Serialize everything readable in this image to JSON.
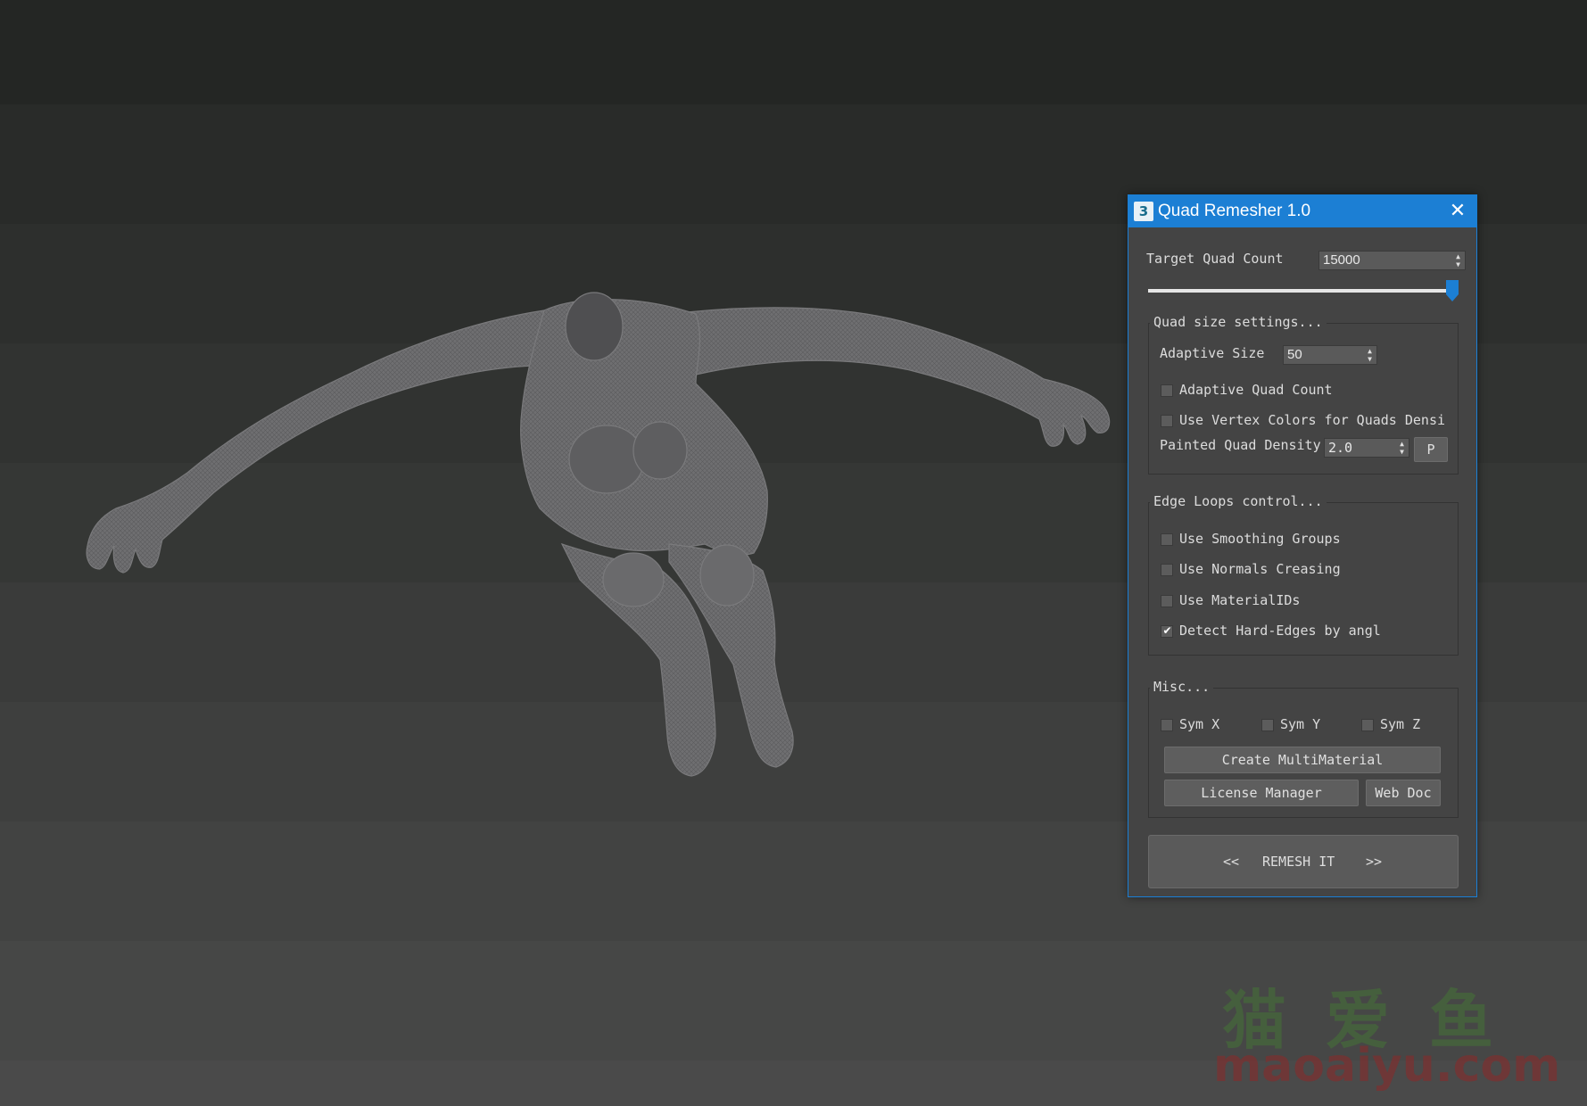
{
  "dialog": {
    "title": "Quad Remesher 1.0",
    "app_icon_glyph": "3",
    "close_glyph": "✕"
  },
  "target_quad_count": {
    "label": "Target Quad Count",
    "value": "15000",
    "slider_position": 0.98
  },
  "quad_size": {
    "title": "Quad size settings...",
    "adaptive_size_label": "Adaptive Size",
    "adaptive_size_value": "50",
    "adaptive_quad_count_label": "Adaptive Quad Count",
    "adaptive_quad_count_checked": false,
    "vertex_colors_label": "Use Vertex Colors for Quads Densi",
    "vertex_colors_checked": false,
    "painted_density_label": "Painted Quad Density",
    "painted_density_value": "2.0",
    "paint_button_label": "P"
  },
  "edge_loops": {
    "title": "Edge Loops control...",
    "items": [
      {
        "label": "Use Smoothing Groups",
        "checked": false
      },
      {
        "label": "Use Normals Creasing",
        "checked": false
      },
      {
        "label": "Use MaterialIDs",
        "checked": false
      },
      {
        "label": "Detect Hard-Edges by angl",
        "checked": true
      }
    ]
  },
  "misc": {
    "title": "Misc...",
    "sym": [
      {
        "label": "Sym X",
        "checked": false
      },
      {
        "label": "Sym Y",
        "checked": false
      },
      {
        "label": "Sym Z",
        "checked": false
      }
    ],
    "create_multimaterial_label": "Create MultiMaterial",
    "license_manager_label": "License Manager",
    "web_doc_label": "Web Doc"
  },
  "remesh": {
    "left_arrows": "<<",
    "label": "REMESH IT",
    "right_arrows": ">>"
  },
  "watermark": {
    "chinese": "猫爱鱼",
    "domain": "maoaiyu.com"
  },
  "colors": {
    "title_bar": "#1c7fd4",
    "dialog_bg": "#444444",
    "slider_thumb": "#1c7fd4",
    "mesh": "#727274"
  }
}
